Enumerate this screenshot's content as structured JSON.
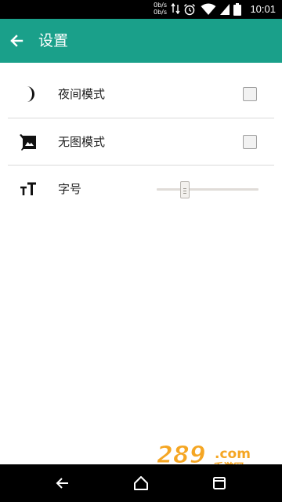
{
  "status_bar": {
    "net_up": "0b/s",
    "net_down": "0b/s",
    "time": "10:01"
  },
  "app_bar": {
    "title": "设置"
  },
  "settings": {
    "night_mode": {
      "label": "夜间模式",
      "checked": false
    },
    "no_image_mode": {
      "label": "无图模式",
      "checked": false
    },
    "font_size": {
      "label": "字号",
      "slider_level": 0.28
    }
  },
  "watermark": {
    "number": "289",
    "suffix": ".com",
    "tagline": "手游网"
  },
  "colors": {
    "accent": "#1aa08a",
    "status_bar": "#000000",
    "nav_bar": "#000000",
    "watermark_orange": "#f5a623"
  }
}
